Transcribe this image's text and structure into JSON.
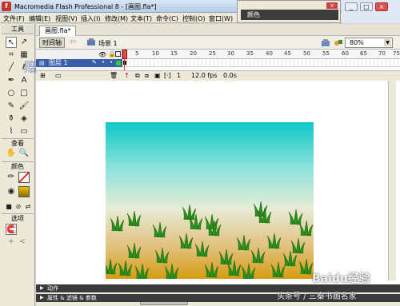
{
  "window": {
    "title": "Macromedia Flash Professional 8 - [画图.fla*]",
    "controls": [
      "_",
      "□",
      "×"
    ]
  },
  "menu": [
    "文件(F)",
    "编辑(E)",
    "视图(V)",
    "插入(I)",
    "修改(M)",
    "文本(T)",
    "命令(C)",
    "控制(O)",
    "窗口(W)"
  ],
  "color_panel": {
    "title": "颜色",
    "close": "×"
  },
  "tools": {
    "header": "工具",
    "view_label": "查看",
    "colors_label": "颜色",
    "options_label": "选项"
  },
  "document": {
    "tab": "画图.fla*",
    "timeline_button": "时间轴",
    "scene": "场景 1",
    "zoom": "80%"
  },
  "timeline": {
    "ticks": [
      "5",
      "10",
      "15",
      "20",
      "25",
      "30",
      "35",
      "40",
      "45",
      "50",
      "55",
      "60",
      "65",
      "70",
      "75"
    ],
    "layer_name": "图层 1",
    "current_frame": "1",
    "fps": "12.0 fps",
    "elapsed": "0.0s"
  },
  "panels": {
    "actions": "动作",
    "properties": "属性 & 滤镜 & 参数"
  },
  "watermark": {
    "baidu": "Baidu经验",
    "author": "头条号 / 三秦书画名家"
  },
  "colors": {
    "stage_top": "#0ec8c8",
    "stage_bottom": "#d69d12",
    "grass": "#2c8f1e",
    "layer_highlight": "#3a5ea8"
  }
}
